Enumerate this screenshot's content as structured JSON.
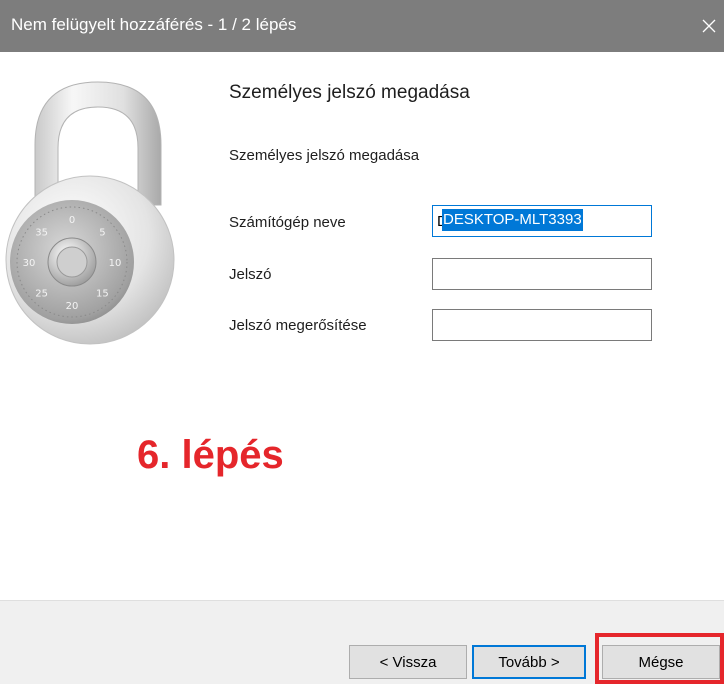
{
  "window": {
    "title": "Nem felügyelt hozzáférés - 1 / 2 lépés",
    "close_glyph": "✕"
  },
  "page": {
    "heading": "Személyes jelszó megadása",
    "subheading": "Személyes jelszó megadása"
  },
  "lock_dial": {
    "numbers": [
      "0",
      "5",
      "10",
      "15",
      "20",
      "25",
      "30",
      "35"
    ]
  },
  "form": {
    "computer_name_label": "Számítógép neve",
    "computer_name_value": "DESKTOP-MLT3393",
    "password_label": "Jelszó",
    "password_value": "",
    "confirm_label": "Jelszó megerősítése",
    "confirm_value": ""
  },
  "annotation": {
    "text": "6. lépés",
    "color": "#e5262b"
  },
  "footer": {
    "back_label": "< Vissza",
    "next_label": "Tovább >",
    "cancel_label": "Mégse"
  },
  "colors": {
    "titlebar": "#7d7d7d",
    "accent": "#0078d7",
    "highlight": "#e5262b"
  }
}
